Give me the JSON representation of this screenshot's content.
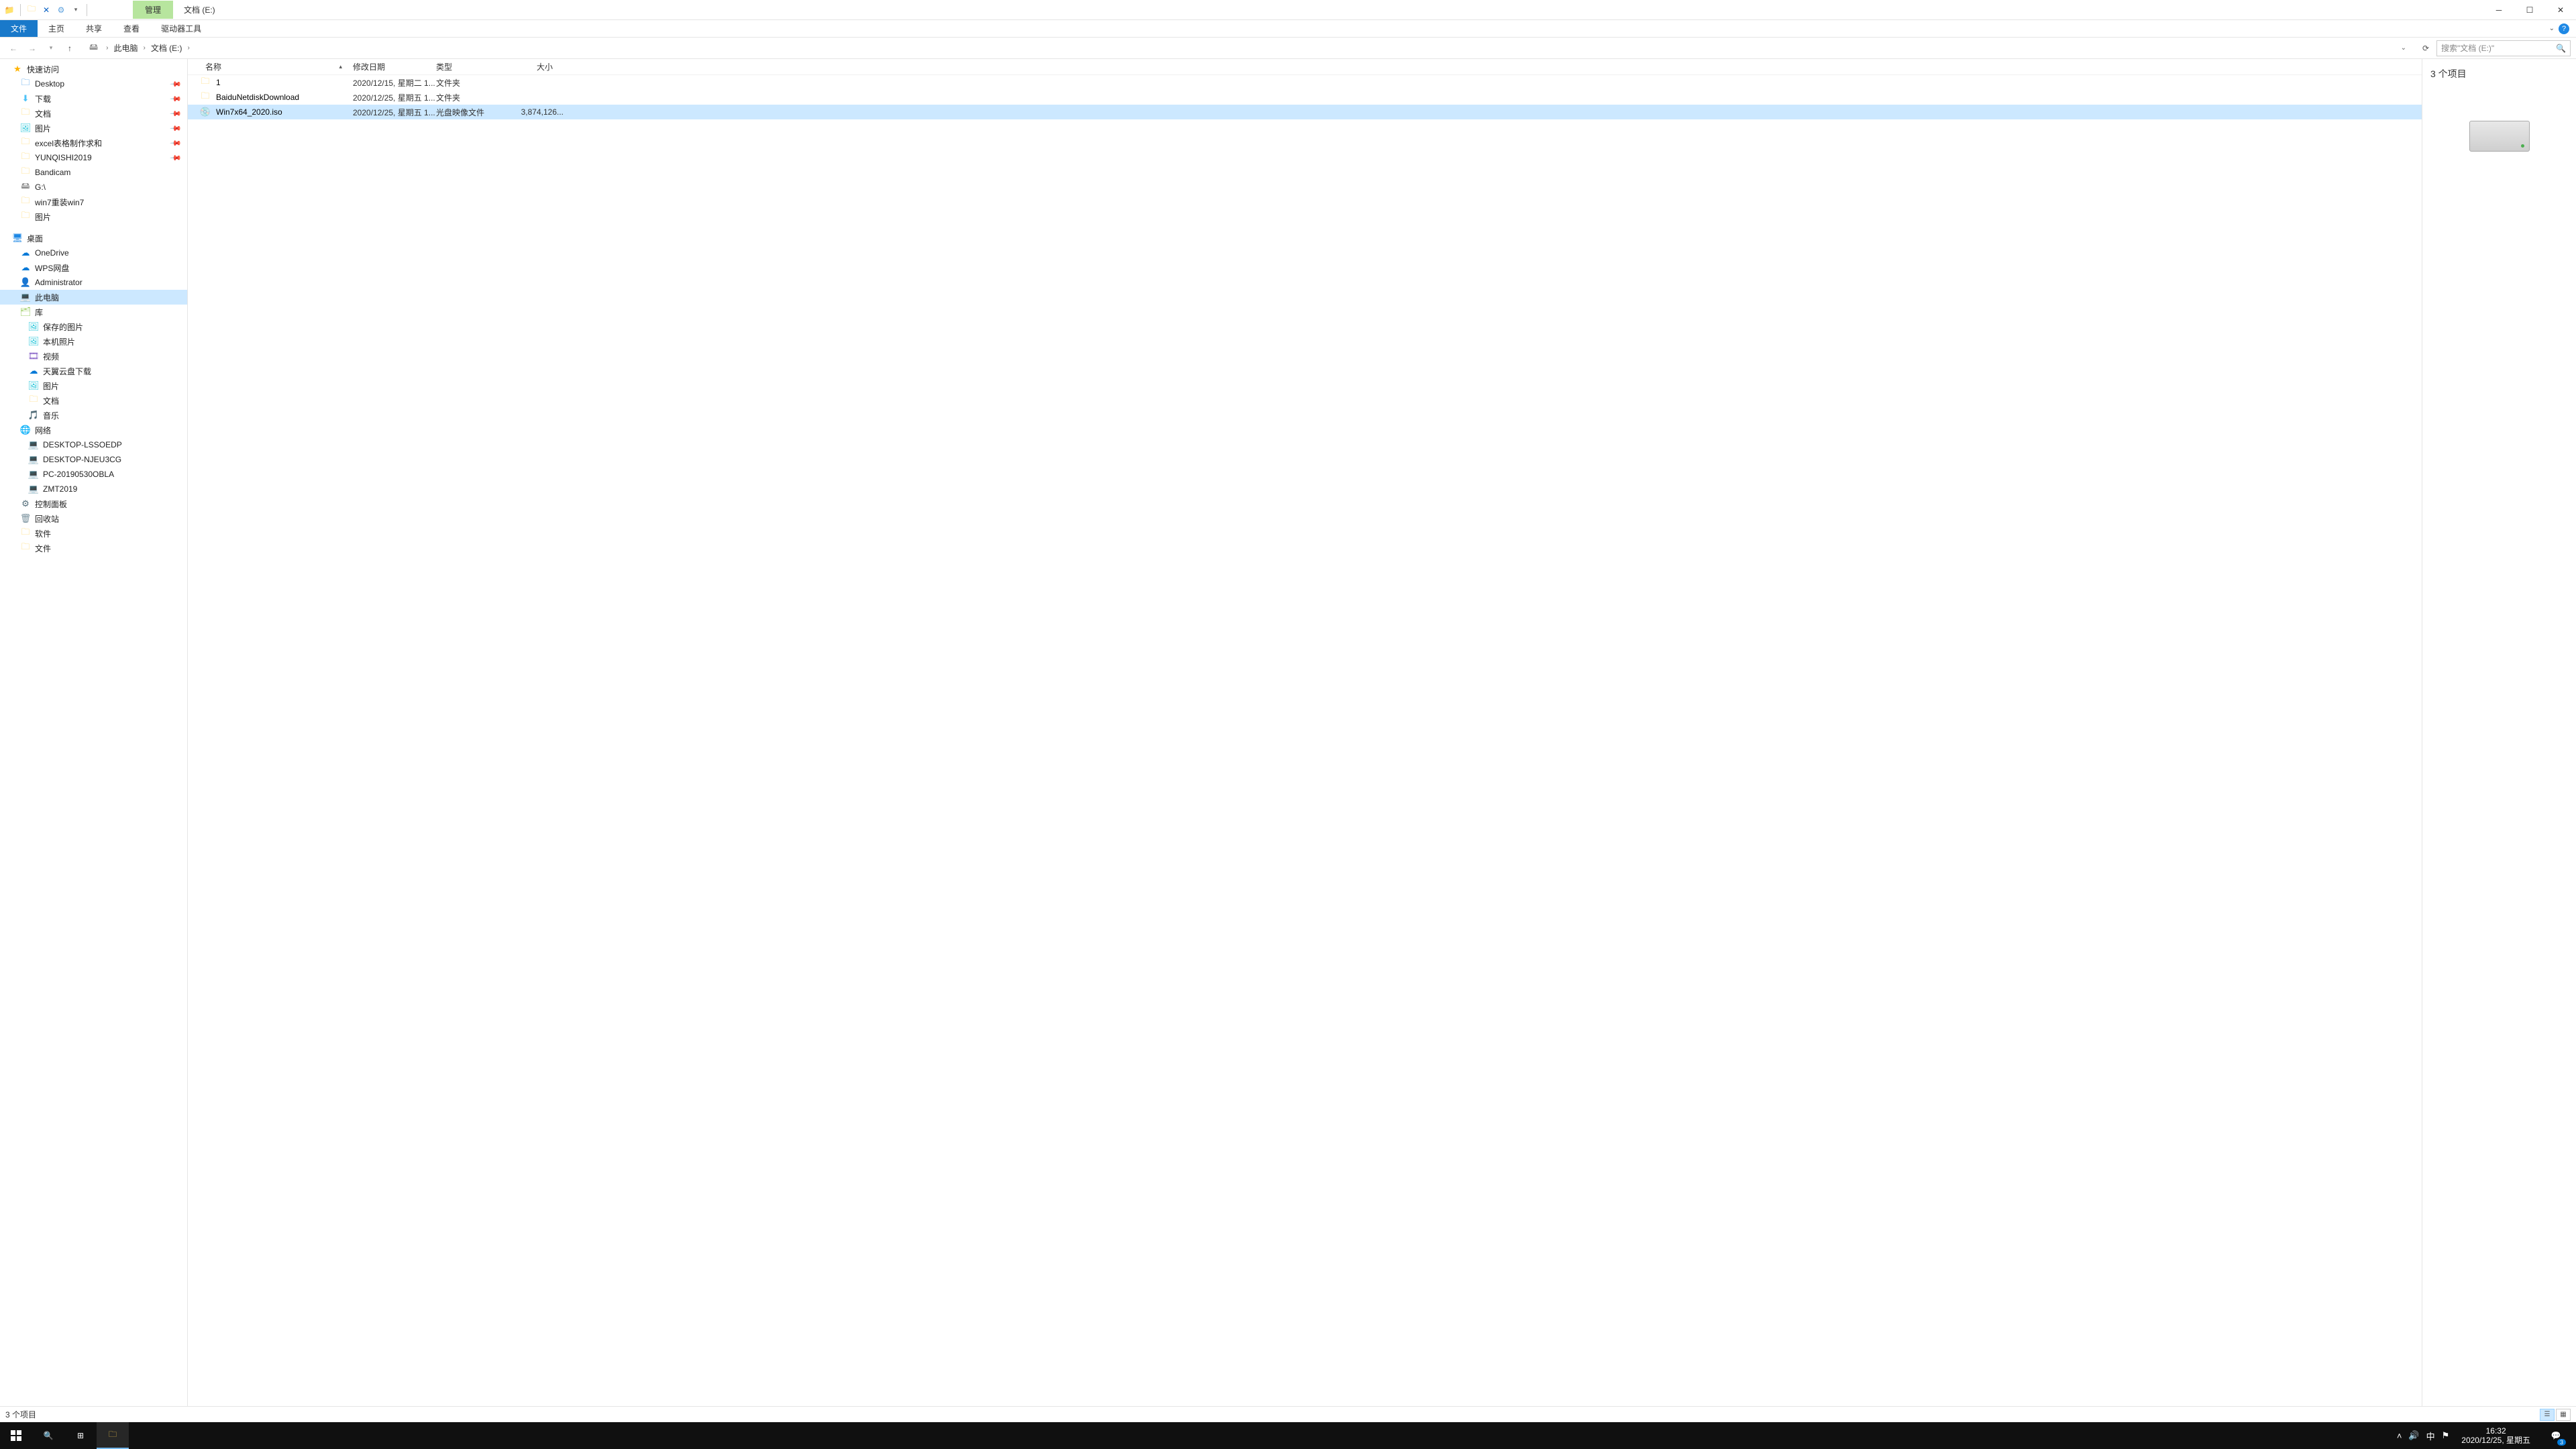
{
  "titlebar": {
    "context_tab": "管理",
    "title": "文档 (E:)"
  },
  "ribbon": {
    "file": "文件",
    "home": "主页",
    "share": "共享",
    "view": "查看",
    "drive_tools": "驱动器工具"
  },
  "address": {
    "root_icon": "💻",
    "seg1": "此电脑",
    "seg2": "文档 (E:)"
  },
  "search": {
    "placeholder": "搜索\"文档 (E:)\""
  },
  "sidebar": {
    "quick_access": "快速访问",
    "desktop": "Desktop",
    "downloads": "下载",
    "documents": "文档",
    "pictures": "图片",
    "excel": "excel表格制作求和",
    "yunqishi": "YUNQISHI2019",
    "bandicam": "Bandicam",
    "gdrive": "G:\\",
    "win7reinstall": "win7重装win7",
    "pictures2": "图片",
    "desktop_zh": "桌面",
    "onedrive": "OneDrive",
    "wps": "WPS网盘",
    "admin": "Administrator",
    "this_pc": "此电脑",
    "library": "库",
    "saved_pics": "保存的图片",
    "camera": "本机照片",
    "video": "视频",
    "tianyi": "天翼云盘下载",
    "lib_pics": "图片",
    "lib_docs": "文档",
    "lib_music": "音乐",
    "network": "网络",
    "pc1": "DESKTOP-LSSOEDP",
    "pc2": "DESKTOP-NJEU3CG",
    "pc3": "PC-20190530OBLA",
    "pc4": "ZMT2019",
    "control_panel": "控制面板",
    "recycle": "回收站",
    "software": "软件",
    "files": "文件"
  },
  "columns": {
    "name": "名称",
    "date": "修改日期",
    "type": "类型",
    "size": "大小"
  },
  "files": [
    {
      "name": "1",
      "date": "2020/12/15, 星期二 1...",
      "type": "文件夹",
      "size": "",
      "icon": "folder"
    },
    {
      "name": "BaiduNetdiskDownload",
      "date": "2020/12/25, 星期五 1...",
      "type": "文件夹",
      "size": "",
      "icon": "folder"
    },
    {
      "name": "Win7x64_2020.iso",
      "date": "2020/12/25, 星期五 1...",
      "type": "光盘映像文件",
      "size": "3,874,126...",
      "icon": "iso",
      "selected": true
    }
  ],
  "preview": {
    "title": "3 个项目"
  },
  "status": {
    "text": "3 个项目"
  },
  "taskbar": {
    "time": "16:32",
    "date": "2020/12/25, 星期五",
    "ime": "中",
    "notif_count": "3"
  }
}
